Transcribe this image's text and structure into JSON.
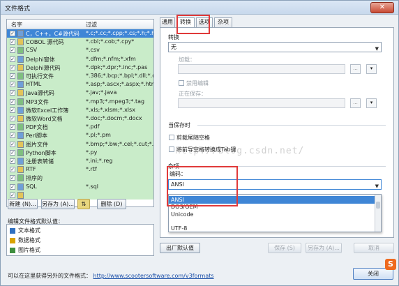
{
  "window": {
    "title": "文件格式",
    "close_glyph": "✕"
  },
  "list": {
    "col_name": "名字",
    "col_mask": "过滤",
    "rows": [
      {
        "name": "C，C++，C#源代码",
        "mask": "*.c;*.cc;*.cpp;*.cs;*.h;*.hpp",
        "checked": true,
        "state": "selected"
      },
      {
        "name": "COBOL 源代码",
        "mask": "*.cbl;*.cob;*.cpy*",
        "checked": true,
        "state": "green"
      },
      {
        "name": "CSV",
        "mask": "*.csv",
        "checked": true,
        "state": "green"
      },
      {
        "name": "Delphi窗体",
        "mask": "*.dfm;*.nfm;*.xfm",
        "checked": true,
        "state": "green"
      },
      {
        "name": "Delphi源代码",
        "mask": "*.dpk;*.dpr;*.inc;*.pas",
        "checked": true,
        "state": "green"
      },
      {
        "name": "可执行文件",
        "mask": "*.386;*.bcp;*.bpl;*.dll;*.dr...",
        "checked": true,
        "state": "green"
      },
      {
        "name": "HTML",
        "mask": "*.asp;*.ascx;*.aspx;*.htm;...",
        "checked": true,
        "state": "green"
      },
      {
        "name": "Java源代码",
        "mask": "*.jav;*.java",
        "checked": true,
        "state": "green"
      },
      {
        "name": "MP3文件",
        "mask": "*.mp3;*.mpeg3;*.tag",
        "checked": true,
        "state": "green"
      },
      {
        "name": "微软Excel工作簿",
        "mask": "*.xls;*.xlsm;*.xlsx",
        "checked": true,
        "state": "green"
      },
      {
        "name": "微软Word文档",
        "mask": "*.doc;*.docm;*.docx",
        "checked": true,
        "state": "green"
      },
      {
        "name": "PDF文档",
        "mask": "*.pdf",
        "checked": true,
        "state": "green"
      },
      {
        "name": "Perl脚本",
        "mask": "*.pl;*.pm",
        "checked": true,
        "state": "green"
      },
      {
        "name": "图片文件",
        "mask": "*.bmp;*.bw;*.cel;*.cut;*.di...",
        "checked": true,
        "state": "green"
      },
      {
        "name": "Python脚本",
        "mask": "*.py",
        "checked": true,
        "state": "green"
      },
      {
        "name": "注册表转储",
        "mask": "*.ini;*.reg",
        "checked": true,
        "state": "green"
      },
      {
        "name": "RTF",
        "mask": "*.rtf",
        "checked": true,
        "state": "green"
      },
      {
        "name": "排序的",
        "mask": "",
        "checked": true,
        "state": "green"
      },
      {
        "name": "SQL",
        "mask": "*.sql",
        "checked": true,
        "state": "green"
      },
      {
        "name": "",
        "mask": "",
        "checked": true,
        "state": "green"
      }
    ]
  },
  "left_buttons": {
    "new": "新建 (N)...",
    "save_as": "另存为 (A)...",
    "arrows": "⇅",
    "delete": "删除 (D)"
  },
  "defaults": {
    "label": "编辑文件格式默认值：",
    "items": [
      {
        "label": "文本格式",
        "color": "#2f6fc0"
      },
      {
        "label": "数据格式",
        "color": "#d9a300"
      },
      {
        "label": "图片格式",
        "color": "#3f8f3f"
      }
    ]
  },
  "tabs": [
    "通用",
    "转换",
    "选项",
    "杂项"
  ],
  "convert": {
    "section_label": "转换",
    "value": "无",
    "load_label": "加载：",
    "disable_edit_label": "禁用编辑",
    "saving_label": "正在保存：",
    "browse_glyph": "...",
    "menu_glyph": "▾"
  },
  "when_saving": {
    "section_label": "当保存时",
    "trim_label": "剪裁尾随空格",
    "tabs_label": "将前导空格转换成Tab键"
  },
  "misc": {
    "section_label": "杂项",
    "encoding_label": "编码：",
    "encoding_value": "ANSI",
    "options": [
      "ANSI",
      "DOS/OEM",
      "Unicode",
      "",
      "UTF-8"
    ]
  },
  "bottom_buttons": {
    "factory": "出厂默认值",
    "save": "保存 (S)",
    "save_as": "另存为 (A)...",
    "cancel": "取消"
  },
  "footer": {
    "text": "可以在这里获得另外的文件格式：",
    "link": "http://www.scootersoftware.com/v3formats",
    "close": "关闭"
  },
  "watermark": "http://blog.csdn.net/",
  "logo_letter": "S"
}
